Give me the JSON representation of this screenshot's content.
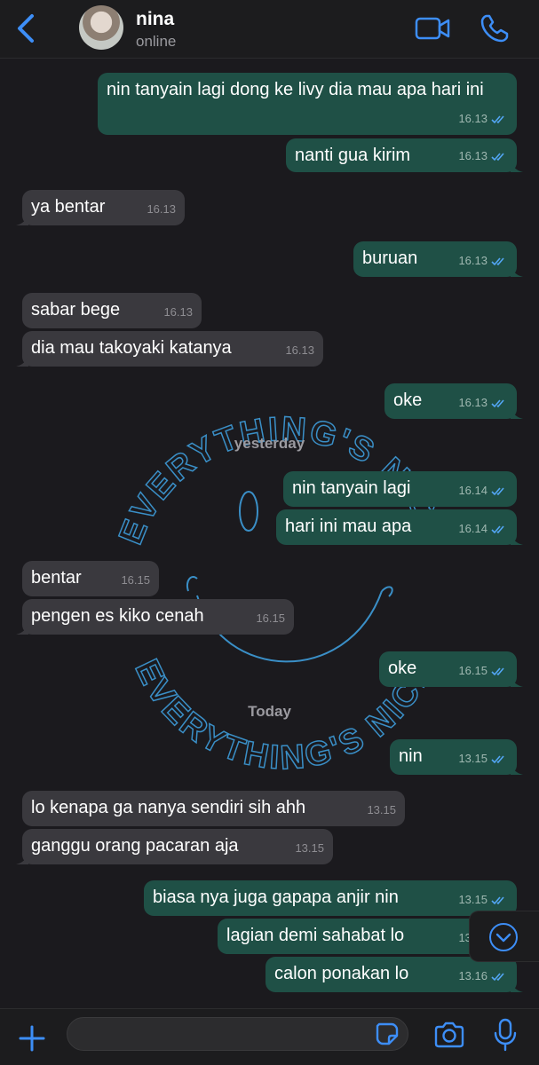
{
  "header": {
    "contact_name": "nina",
    "status": "online"
  },
  "wallpaper": {
    "top_text": "EVERYTHING'S NICE",
    "bottom_text": "EVERYTHING'S NICE"
  },
  "dates": {
    "yesterday": "yesterday",
    "today": "Today"
  },
  "messages": [
    {
      "dir": "out",
      "text": "nin tanyain lagi dong ke livy dia mau apa hari ini",
      "time": "16.13"
    },
    {
      "dir": "out",
      "text": "nanti gua kirim",
      "time": "16.13"
    },
    {
      "dir": "in",
      "text": "ya bentar",
      "time": "16.13"
    },
    {
      "dir": "out",
      "text": "buruan",
      "time": "16.13"
    },
    {
      "dir": "in",
      "text": "sabar bege",
      "time": "16.13"
    },
    {
      "dir": "in",
      "text": "dia mau takoyaki katanya",
      "time": "16.13"
    },
    {
      "dir": "out",
      "text": "oke",
      "time": "16.13"
    },
    {
      "dir": "out",
      "text": "nin tanyain lagi",
      "time": "16.14"
    },
    {
      "dir": "out",
      "text": "hari ini mau apa",
      "time": "16.14"
    },
    {
      "dir": "in",
      "text": "bentar",
      "time": "16.15"
    },
    {
      "dir": "in",
      "text": "pengen es kiko cenah",
      "time": "16.15"
    },
    {
      "dir": "out",
      "text": "oke",
      "time": "16.15"
    },
    {
      "dir": "out",
      "text": "nin",
      "time": "13.15"
    },
    {
      "dir": "in",
      "text": "lo kenapa ga nanya sendiri sih ahh",
      "time": "13.15"
    },
    {
      "dir": "in",
      "text": "ganggu orang pacaran aja",
      "time": "13.15"
    },
    {
      "dir": "out",
      "text": "biasa nya juga gapapa anjir nin",
      "time": "13.15"
    },
    {
      "dir": "out",
      "text": "lagian demi sahabat lo",
      "time": "13.15"
    },
    {
      "dir": "out",
      "text": "calon ponakan lo",
      "time": "13.16"
    }
  ],
  "input": {
    "value": "",
    "placeholder": ""
  },
  "icons": {
    "back": "chevron-left-icon",
    "video": "video-camera-icon",
    "call": "phone-icon",
    "scroll": "chevron-down-circle-icon",
    "plus": "plus-icon",
    "sticker": "sticker-icon",
    "camera": "camera-icon",
    "mic": "microphone-icon"
  },
  "colors": {
    "accent": "#3d8ef7",
    "outgoing_bubble": "#1f5046",
    "incoming_bubble": "#3a393e",
    "background": "#1b1a1e",
    "read_ticks": "#53a6f5"
  }
}
